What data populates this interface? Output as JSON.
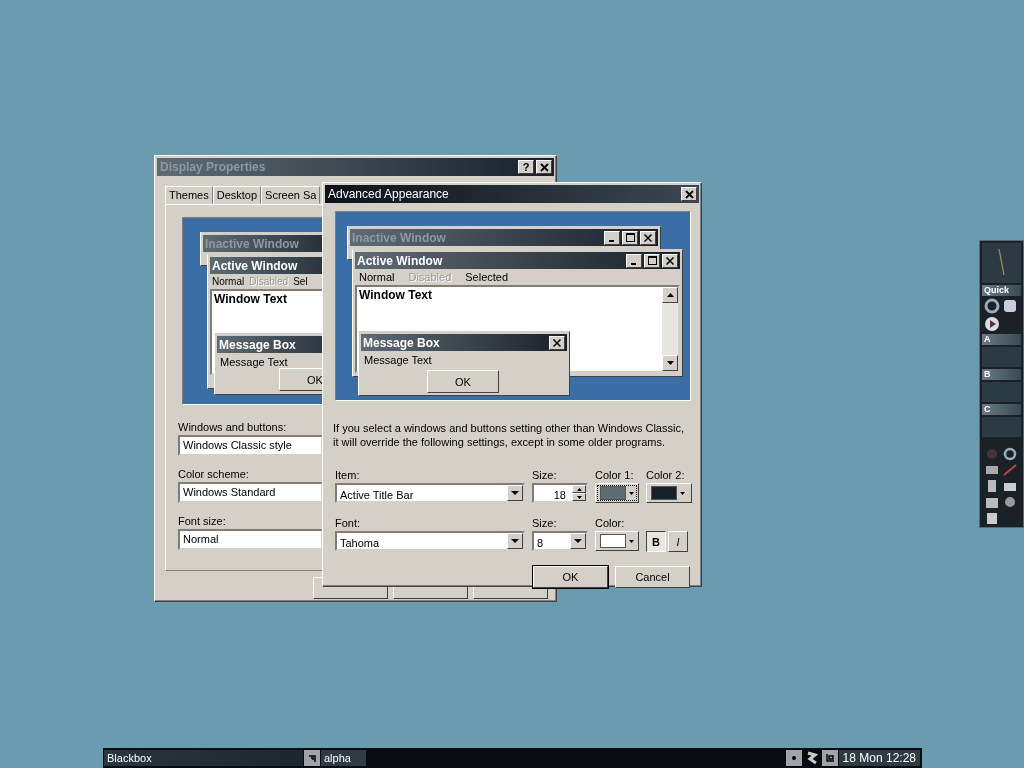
{
  "display_properties": {
    "title": "Display Properties",
    "help_button": "?",
    "tabs": [
      {
        "label": "Themes",
        "selected": false
      },
      {
        "label": "Desktop",
        "selected": false
      },
      {
        "label": "Screen Sa",
        "selected": false
      }
    ],
    "preview": {
      "inactive_title": "Inactive Window",
      "active_title": "Active Window",
      "menu": [
        {
          "label": "Normal",
          "disabled": false
        },
        {
          "label": "Disabled",
          "disabled": true
        },
        {
          "label": "Sel",
          "disabled": false
        }
      ],
      "window_text": "Window Text",
      "message_title": "Message Box",
      "message_text": "Message Text",
      "ok": "OK"
    },
    "fields": [
      {
        "label": "Windows and buttons:",
        "value": "Windows Classic style"
      },
      {
        "label": "Color scheme:",
        "value": "Windows Standard"
      },
      {
        "label": "Font size:",
        "value": "Normal"
      }
    ]
  },
  "advanced": {
    "title": "Advanced Appearance",
    "preview": {
      "inactive_title": "Inactive Window",
      "active_title": "Active Window",
      "menu": [
        {
          "label": "Normal",
          "disabled": false
        },
        {
          "label": "Disabled",
          "disabled": true
        },
        {
          "label": "Selected",
          "disabled": false
        }
      ],
      "window_text": "Window Text",
      "message_title": "Message Box",
      "message_text": "Message Text",
      "ok": "OK"
    },
    "note": "If you select a windows and buttons setting other than Windows Classic, it will override the following settings, except in some older programs.",
    "item": {
      "label": "Item:",
      "value": "Active Title Bar"
    },
    "item_size": {
      "label": "Size:",
      "value": "18"
    },
    "color_1": {
      "label": "Color 1:",
      "color": "#5f6b72"
    },
    "color_2": {
      "label": "Color 2:",
      "color": "#18202c"
    },
    "font": {
      "label": "Font:",
      "value": "Tahoma"
    },
    "font_size": {
      "label": "Size:",
      "value": "8"
    },
    "font_color": {
      "label": "Color:",
      "color": "#ffffff"
    },
    "bold": {
      "label": "B",
      "on": true
    },
    "italic": {
      "label": "I",
      "on": false
    },
    "buttons": [
      "OK",
      "Cancel"
    ]
  },
  "slit": {
    "sections": [
      "Quick",
      "A",
      "B",
      "C"
    ]
  },
  "taskbar": {
    "workspace": "Blackbox",
    "window": "alpha",
    "clock": "18 Mon 12:28"
  }
}
